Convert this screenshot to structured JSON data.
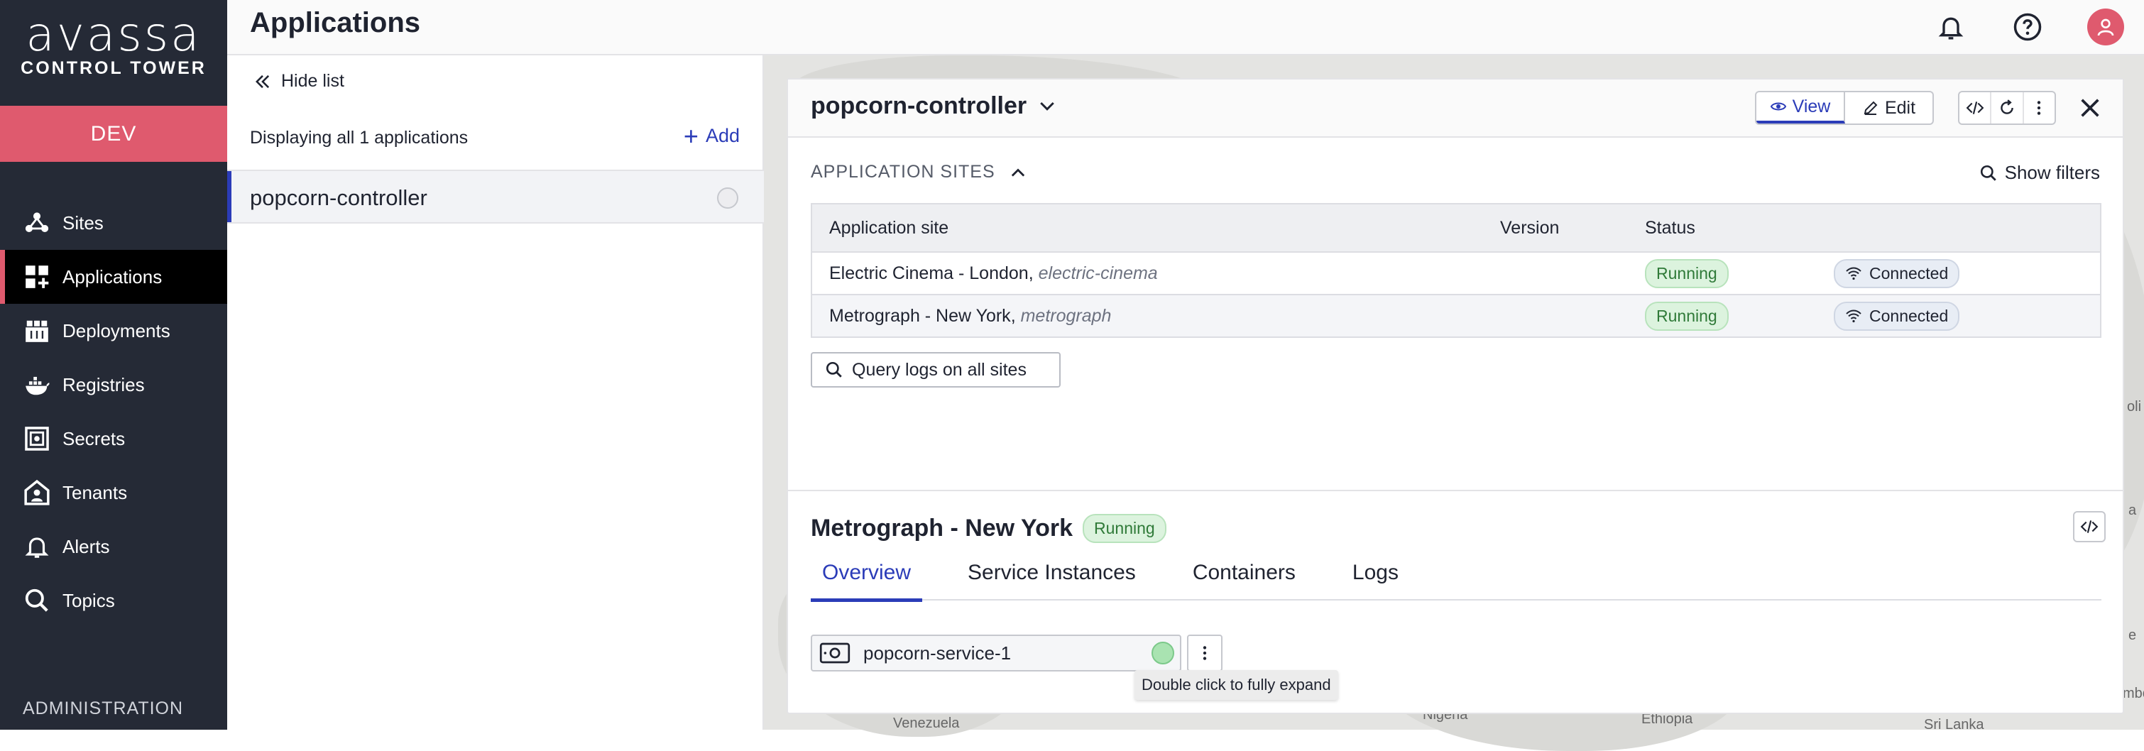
{
  "brand": {
    "logo_text": "avassa",
    "subtitle": "CONTROL TOWER"
  },
  "env": {
    "label": "DEV"
  },
  "sidebar": {
    "items": [
      {
        "label": "Sites",
        "icon": "sites-icon"
      },
      {
        "label": "Applications",
        "icon": "applications-icon",
        "active": true
      },
      {
        "label": "Deployments",
        "icon": "deployments-icon"
      },
      {
        "label": "Registries",
        "icon": "registries-icon"
      },
      {
        "label": "Secrets",
        "icon": "secrets-icon"
      },
      {
        "label": "Tenants",
        "icon": "tenants-icon"
      },
      {
        "label": "Alerts",
        "icon": "bell-icon"
      },
      {
        "label": "Topics",
        "icon": "search-icon"
      }
    ],
    "admin_label": "ADMINISTRATION"
  },
  "header": {
    "title": "Applications"
  },
  "list": {
    "hide_label": "Hide list",
    "display_prefix": "Displaying all ",
    "display_count": "1",
    "display_suffix": " applications",
    "add_label": "Add",
    "items": [
      {
        "name": "popcorn-controller"
      }
    ]
  },
  "map": {
    "labels": [
      "Venezuela",
      "Nigeria",
      "Ethiopia",
      "Sri Lanka",
      "oli",
      "a",
      "e",
      "mbo"
    ]
  },
  "detail": {
    "title": "popcorn-controller",
    "view_label": "View",
    "edit_label": "Edit",
    "sites_section_label": "APPLICATION SITES",
    "show_filters_label": "Show filters",
    "table": {
      "columns": [
        "Application site",
        "Version",
        "Status",
        ""
      ],
      "rows": [
        {
          "site": "Electric Cinema - London",
          "slug": "electric-cinema",
          "version": "",
          "status": "Running",
          "connection": "Connected"
        },
        {
          "site": "Metrograph - New York",
          "slug": "metrograph",
          "version": "",
          "status": "Running",
          "connection": "Connected"
        }
      ]
    },
    "query_logs_label": "Query logs on all sites",
    "selected_site": {
      "title": "Metrograph - New York",
      "status": "Running",
      "tabs": [
        "Overview",
        "Service Instances",
        "Containers",
        "Logs"
      ],
      "service": {
        "name": "popcorn-service-1"
      },
      "tooltip": "Double click to fully expand"
    }
  },
  "colors": {
    "sidebar_bg": "#252a36",
    "accent_pink": "#df5a6e",
    "accent_blue": "#2b3cb8",
    "running_green": "#2f7a38"
  }
}
